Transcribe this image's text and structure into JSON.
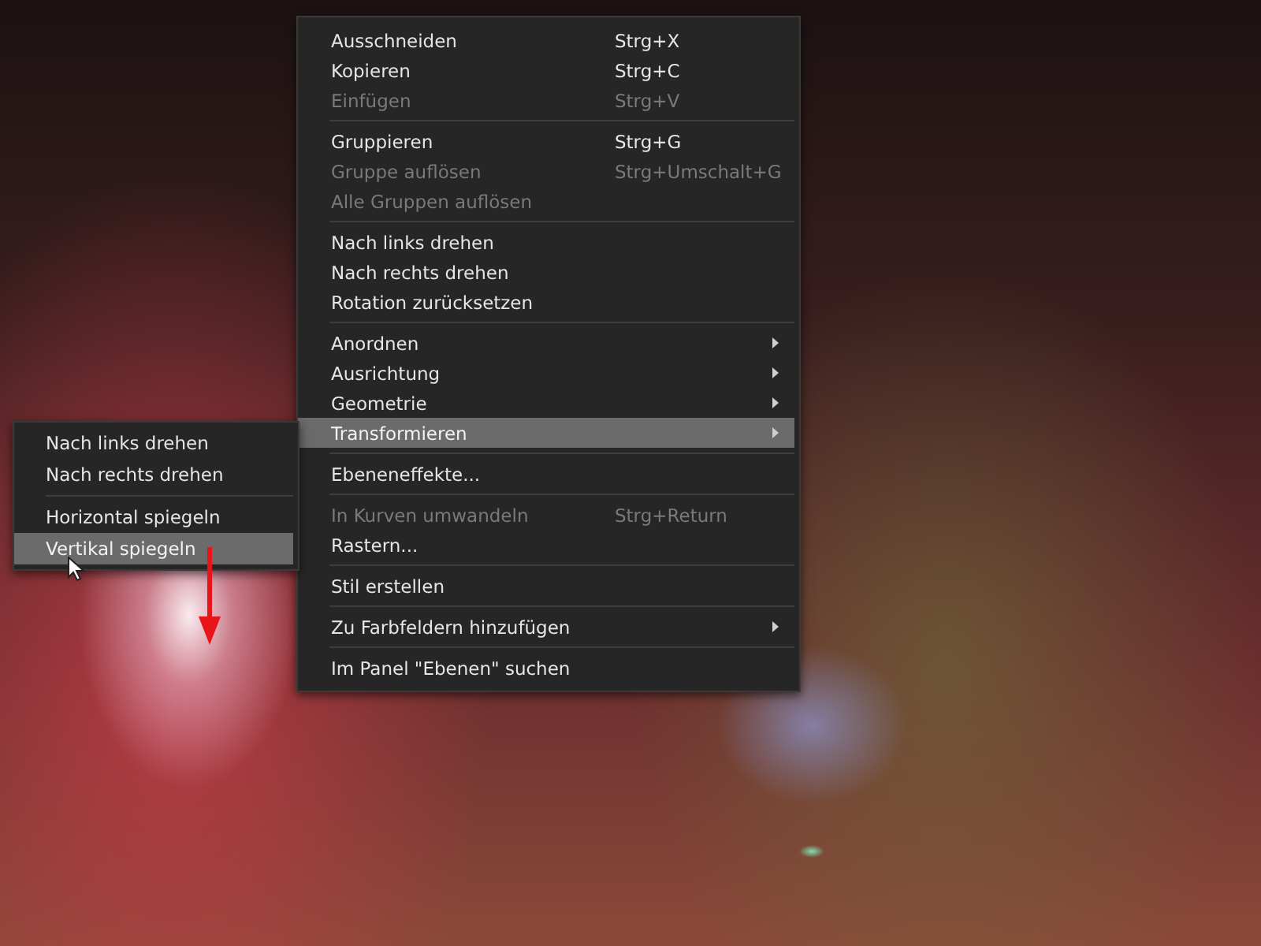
{
  "context_menu": {
    "items": [
      {
        "kind": "item",
        "label": "Ausschneiden",
        "shortcut": "Strg+X",
        "disabled": false,
        "selected": false,
        "submenu": false
      },
      {
        "kind": "item",
        "label": "Kopieren",
        "shortcut": "Strg+C",
        "disabled": false,
        "selected": false,
        "submenu": false
      },
      {
        "kind": "item",
        "label": "Einfügen",
        "shortcut": "Strg+V",
        "disabled": true,
        "selected": false,
        "submenu": false
      },
      {
        "kind": "separator"
      },
      {
        "kind": "item",
        "label": "Gruppieren",
        "shortcut": "Strg+G",
        "disabled": false,
        "selected": false,
        "submenu": false
      },
      {
        "kind": "item",
        "label": "Gruppe auflösen",
        "shortcut": "Strg+Umschalt+G",
        "disabled": true,
        "selected": false,
        "submenu": false
      },
      {
        "kind": "item",
        "label": "Alle Gruppen auflösen",
        "disabled": true,
        "selected": false,
        "submenu": false
      },
      {
        "kind": "separator"
      },
      {
        "kind": "item",
        "label": "Nach links drehen",
        "disabled": false,
        "selected": false,
        "submenu": false
      },
      {
        "kind": "item",
        "label": "Nach rechts drehen",
        "disabled": false,
        "selected": false,
        "submenu": false
      },
      {
        "kind": "item",
        "label": "Rotation zurücksetzen",
        "disabled": false,
        "selected": false,
        "submenu": false
      },
      {
        "kind": "separator"
      },
      {
        "kind": "item",
        "label": "Anordnen",
        "disabled": false,
        "selected": false,
        "submenu": true
      },
      {
        "kind": "item",
        "label": "Ausrichtung",
        "disabled": false,
        "selected": false,
        "submenu": true
      },
      {
        "kind": "item",
        "label": "Geometrie",
        "disabled": false,
        "selected": false,
        "submenu": true
      },
      {
        "kind": "item",
        "label": "Transformieren",
        "disabled": false,
        "selected": true,
        "submenu": true
      },
      {
        "kind": "separator"
      },
      {
        "kind": "item",
        "label": "Ebeneneffekte...",
        "disabled": false,
        "selected": false,
        "submenu": false
      },
      {
        "kind": "separator"
      },
      {
        "kind": "item",
        "label": "In Kurven umwandeln",
        "shortcut": "Strg+Return",
        "disabled": true,
        "selected": false,
        "submenu": false
      },
      {
        "kind": "item",
        "label": "Rastern...",
        "disabled": false,
        "selected": false,
        "submenu": false
      },
      {
        "kind": "separator"
      },
      {
        "kind": "item",
        "label": "Stil erstellen",
        "disabled": false,
        "selected": false,
        "submenu": false
      },
      {
        "kind": "separator"
      },
      {
        "kind": "item",
        "label": "Zu Farbfeldern hinzufügen",
        "disabled": false,
        "selected": false,
        "submenu": true
      },
      {
        "kind": "separator"
      },
      {
        "kind": "item",
        "label": "Im Panel \"Ebenen\" suchen",
        "disabled": false,
        "selected": false,
        "submenu": false
      }
    ]
  },
  "submenu": {
    "items": [
      {
        "kind": "item",
        "label": "Nach links drehen",
        "disabled": false,
        "selected": false
      },
      {
        "kind": "item",
        "label": "Nach rechts drehen",
        "disabled": false,
        "selected": false
      },
      {
        "kind": "separator"
      },
      {
        "kind": "item",
        "label": "Horizontal spiegeln",
        "disabled": false,
        "selected": false
      },
      {
        "kind": "item",
        "label": "Vertikal spiegeln",
        "disabled": false,
        "selected": true
      }
    ]
  }
}
